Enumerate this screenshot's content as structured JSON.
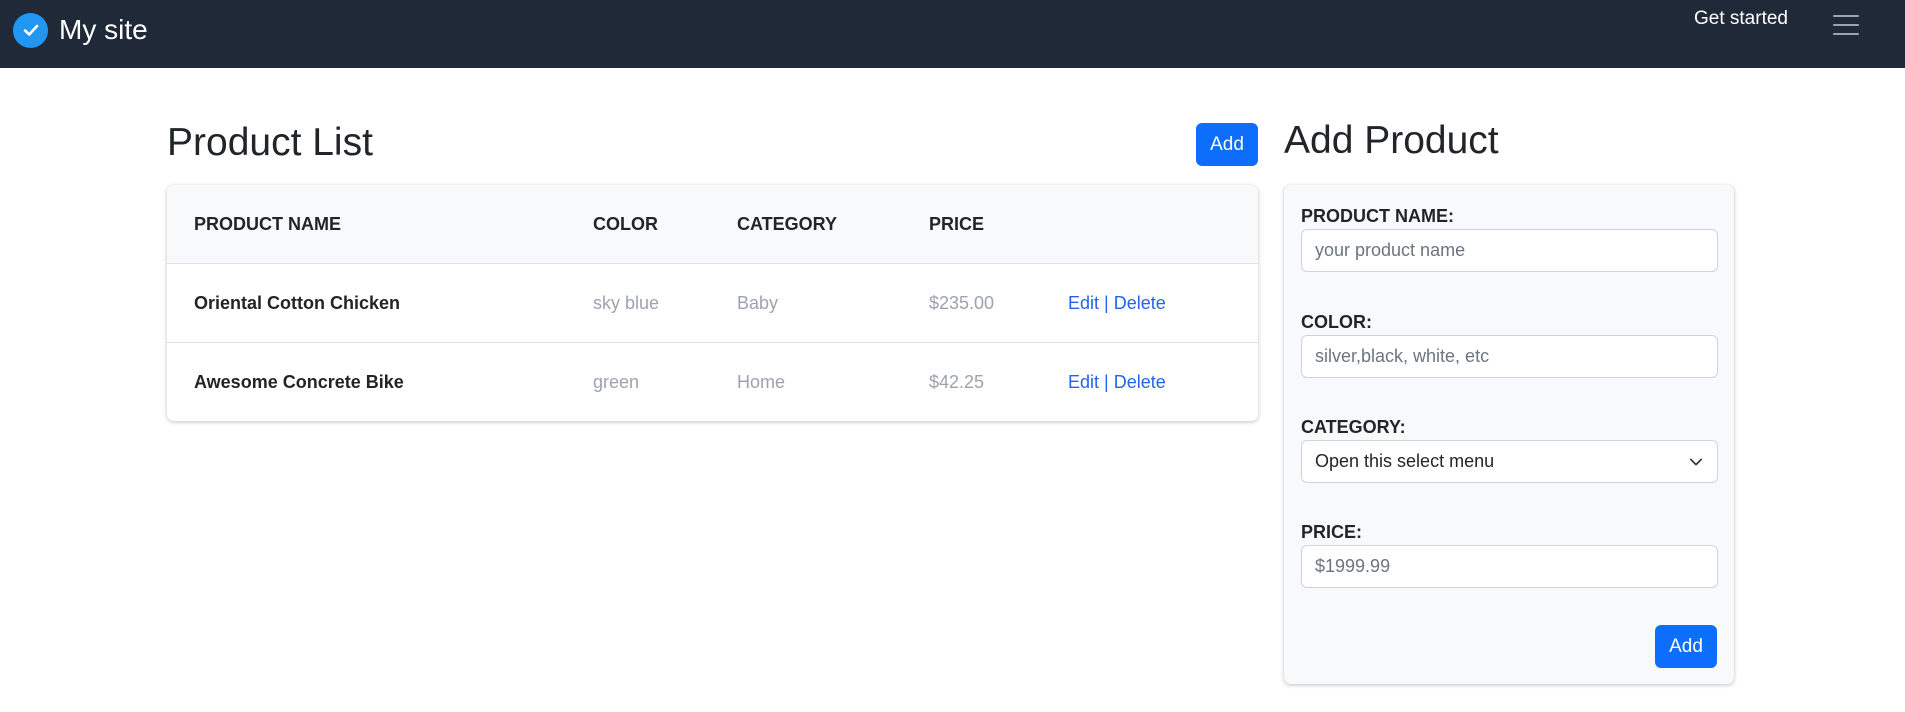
{
  "navbar": {
    "brand_name": "My site",
    "get_started": "Get started"
  },
  "product_list": {
    "title": "Product List",
    "add_button": "Add",
    "columns": [
      "PRODUCT NAME",
      "COLOR",
      "CATEGORY",
      "PRICE"
    ],
    "rows": [
      {
        "name": "Oriental Cotton Chicken",
        "color": "sky blue",
        "category": "Baby",
        "price": "$235.00",
        "edit": "Edit",
        "separator": "|",
        "delete": "Delete"
      },
      {
        "name": "Awesome Concrete Bike",
        "color": "green",
        "category": "Home",
        "price": "$42.25",
        "edit": "Edit",
        "separator": "|",
        "delete": "Delete"
      }
    ]
  },
  "add_form": {
    "title": "Add Product",
    "name_label": "PRODUCT NAME:",
    "name_placeholder": "your product name",
    "color_label": "COLOR:",
    "color_placeholder": "silver,black, white, etc",
    "category_label": "CATEGORY:",
    "category_selected": "Open this select menu",
    "price_label": "PRICE:",
    "price_placeholder": "$1999.99",
    "submit_button": "Add"
  },
  "colors": {
    "navbar_bg": "#1f2937",
    "brand_logo": "#2196f3",
    "primary": "#0d6efd",
    "link": "#2563eb"
  },
  "icons": {
    "brand": "check-circle-icon",
    "menu": "hamburger-menu-icon",
    "select": "chevron-down-icon"
  }
}
